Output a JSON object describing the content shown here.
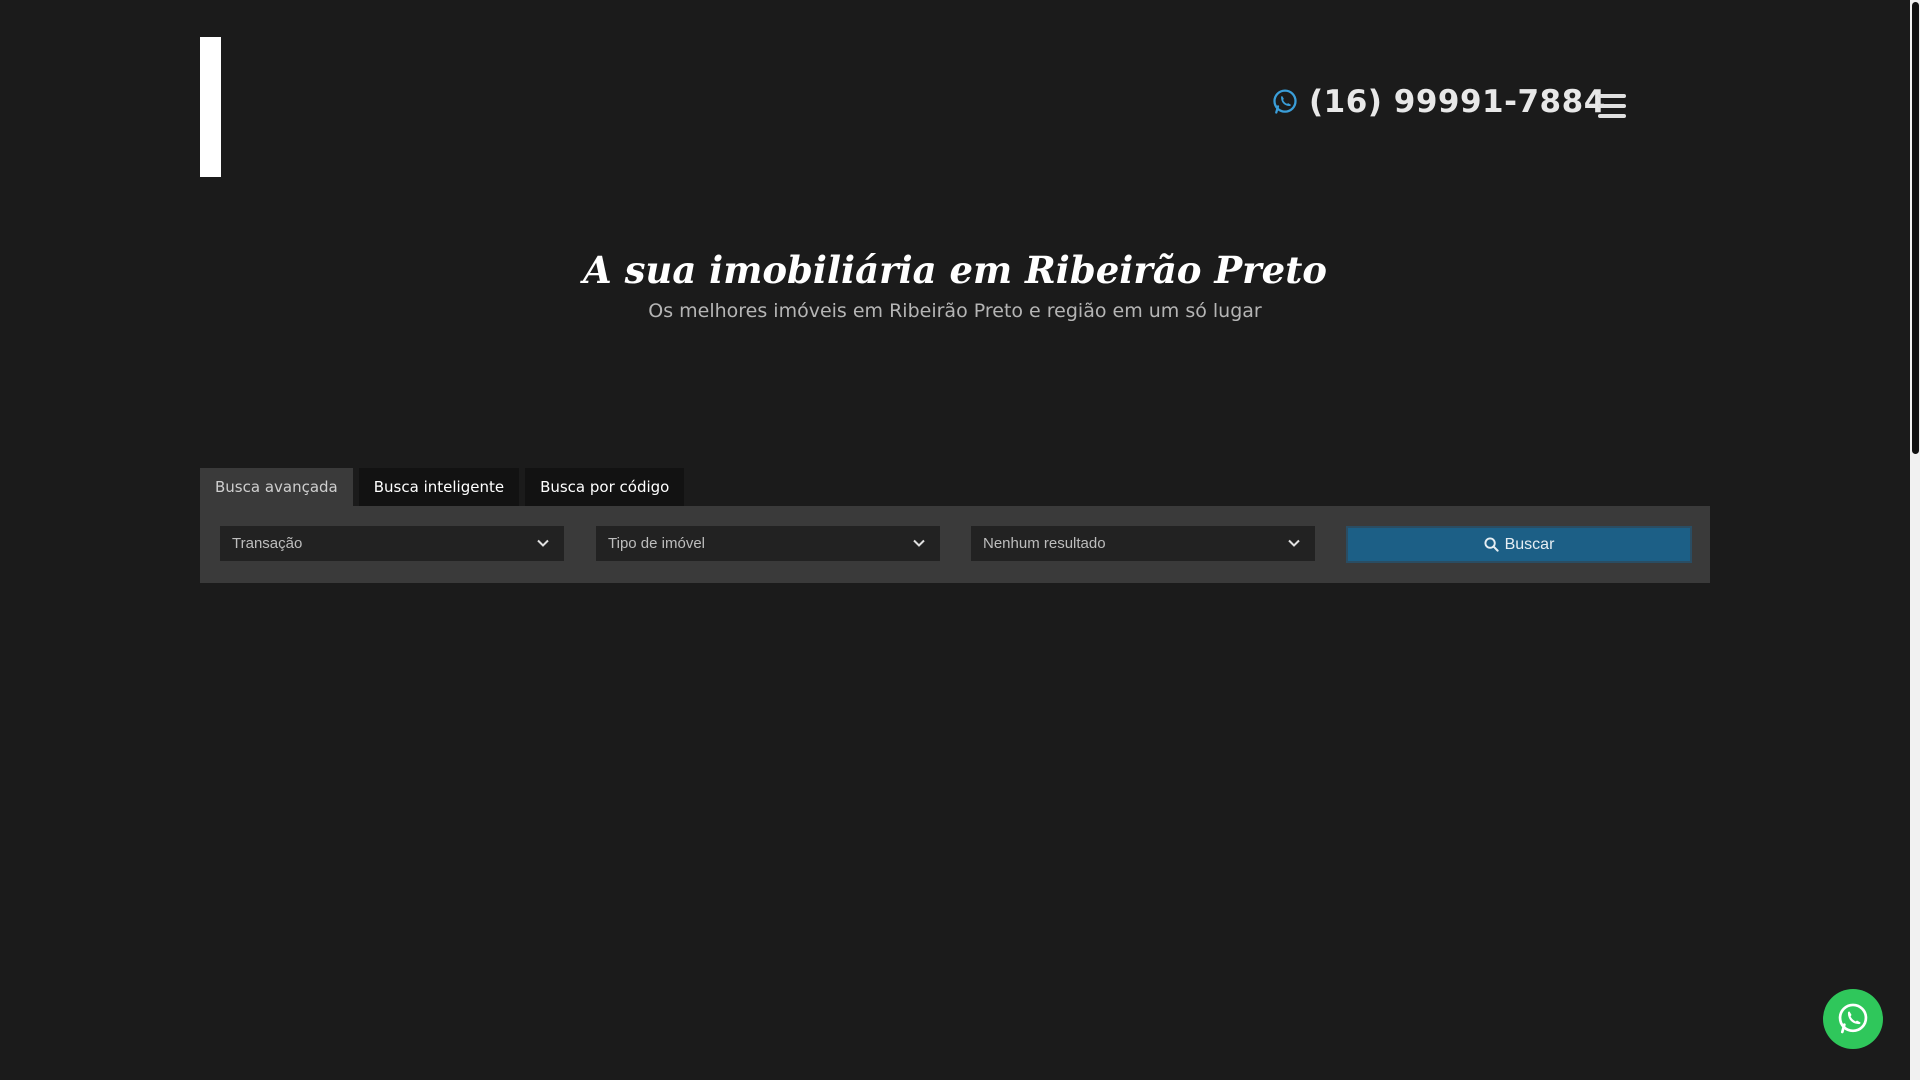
{
  "header": {
    "phone": "(16) 99991-7884",
    "phone_icon": "whatsapp-icon",
    "menu_icon": "hamburger-menu-icon"
  },
  "hero": {
    "title": "A sua imobiliária em Ribeirão Preto",
    "subtitle": "Os melhores imóveis em Ribeirão Preto e região em um só lugar"
  },
  "search": {
    "tabs": [
      {
        "label": "Busca avançada",
        "active": true
      },
      {
        "label": "Busca inteligente",
        "active": false
      },
      {
        "label": "Busca por código",
        "active": false
      }
    ],
    "fields": [
      {
        "selected": "Transação"
      },
      {
        "selected": "Tipo de imóvel"
      },
      {
        "selected": "Nenhum resultado"
      }
    ],
    "button_label": "Buscar"
  },
  "colors": {
    "background": "#1b1b1b",
    "accent": "#1c5f86",
    "whatsapp": "#2fc75b",
    "phone_icon": "#3a9ed9"
  }
}
